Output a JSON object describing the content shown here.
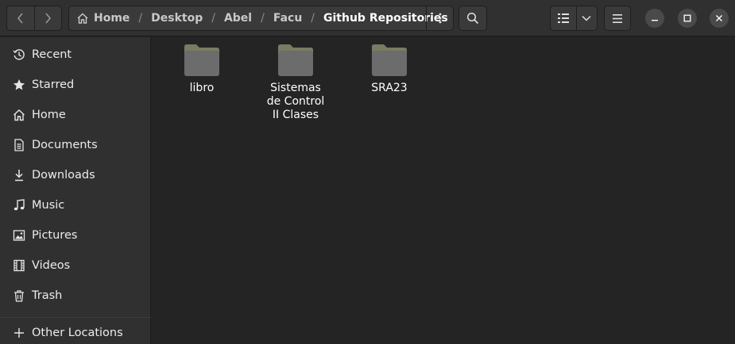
{
  "header": {
    "back_icon": "chevron-left-icon",
    "forward_icon": "chevron-right-icon",
    "breadcrumbs": [
      {
        "label": "Home"
      },
      {
        "label": "Desktop"
      },
      {
        "label": "Abel"
      },
      {
        "label": "Facu"
      },
      {
        "label": "Github Repositories"
      }
    ],
    "separator": "/",
    "path_menu_icon": "vertical-dots-icon",
    "search_icon": "search-icon",
    "view_icon": "list-view-icon",
    "view_dropdown_icon": "chevron-down-icon",
    "main_menu_icon": "hamburger-menu-icon",
    "window_controls": [
      "minimize-icon",
      "maximize-icon",
      "close-icon"
    ]
  },
  "sidebar": {
    "items": [
      {
        "label": "Recent",
        "icon": "clock-icon"
      },
      {
        "label": "Starred",
        "icon": "star-icon"
      },
      {
        "label": "Home",
        "icon": "home-icon"
      },
      {
        "label": "Documents",
        "icon": "document-icon"
      },
      {
        "label": "Downloads",
        "icon": "download-icon"
      },
      {
        "label": "Music",
        "icon": "music-icon"
      },
      {
        "label": "Pictures",
        "icon": "picture-icon"
      },
      {
        "label": "Videos",
        "icon": "video-icon"
      },
      {
        "label": "Trash",
        "icon": "trash-icon"
      }
    ],
    "other_locations": {
      "label": "Other Locations",
      "icon": "plus-icon"
    }
  },
  "main": {
    "folders": [
      {
        "name": "libro"
      },
      {
        "name": "Sistemas de Control II Clases"
      },
      {
        "name": "SRA23"
      }
    ]
  },
  "colors": {
    "window_bg": "#242424",
    "headerbar_bg": "#303030",
    "folder_body": "#6c6c6c",
    "folder_tab": "#7b7b62"
  }
}
